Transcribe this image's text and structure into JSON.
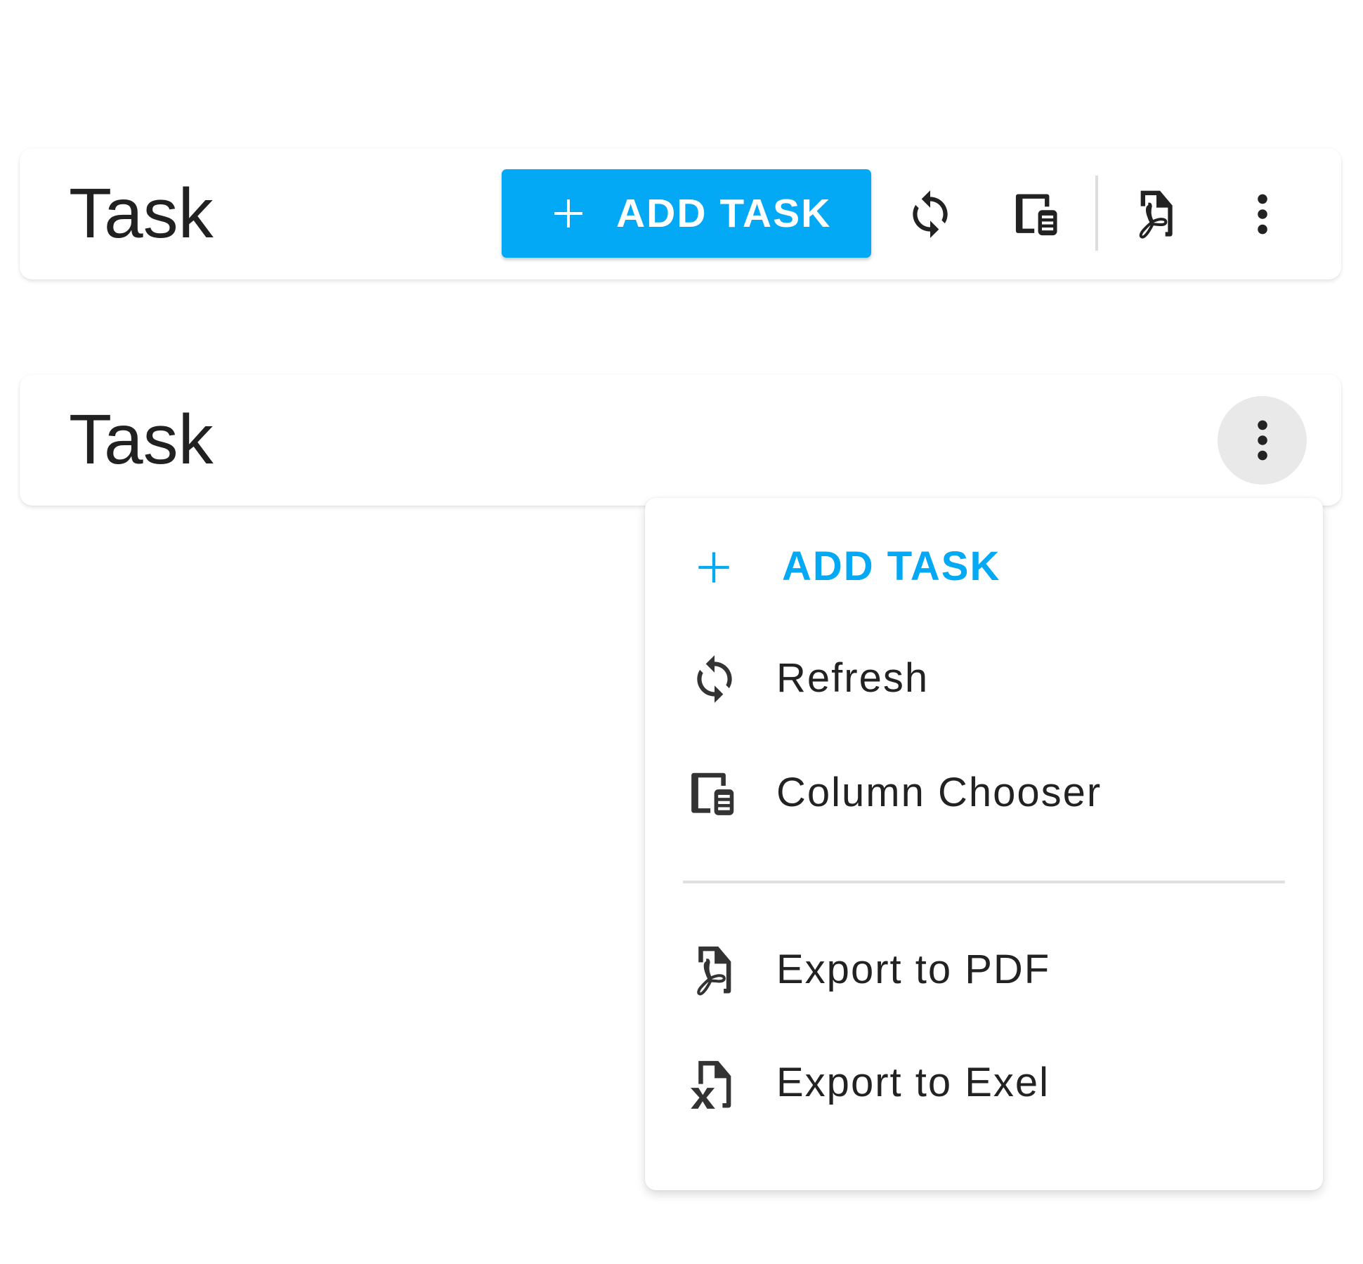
{
  "colors": {
    "accent": "#03A9F4",
    "text_primary": "#212121",
    "menu_text": "#222222",
    "icon_dark": "#222222",
    "icon_menu": "#333333",
    "active_circle": "#e9e9e9",
    "divider": "#e0e0e0"
  },
  "toolbar_expanded": {
    "title": "Task",
    "add_button": {
      "label": "ADD TASK",
      "icon": "plus-icon"
    },
    "icons": [
      {
        "name": "refresh",
        "icon": "refresh-icon"
      },
      {
        "name": "column-chooser",
        "icon": "column-chooser-icon"
      },
      {
        "name": "export-pdf",
        "icon": "pdf-file-icon"
      },
      {
        "name": "more",
        "icon": "more-vert-icon"
      }
    ]
  },
  "toolbar_collapsed": {
    "title": "Task",
    "more_button": {
      "icon": "more-vert-icon",
      "state": "active"
    }
  },
  "overflow_menu": {
    "items": [
      {
        "label": "ADD TASK",
        "icon": "plus-icon",
        "primary": true
      },
      {
        "label": "Refresh",
        "icon": "refresh-icon"
      },
      {
        "label": "Column Chooser",
        "icon": "column-chooser-icon"
      },
      {
        "label": "Export to PDF",
        "icon": "pdf-file-icon",
        "group": 2
      },
      {
        "label": "Export to Exel",
        "icon": "excel-file-icon",
        "group": 2
      }
    ]
  }
}
